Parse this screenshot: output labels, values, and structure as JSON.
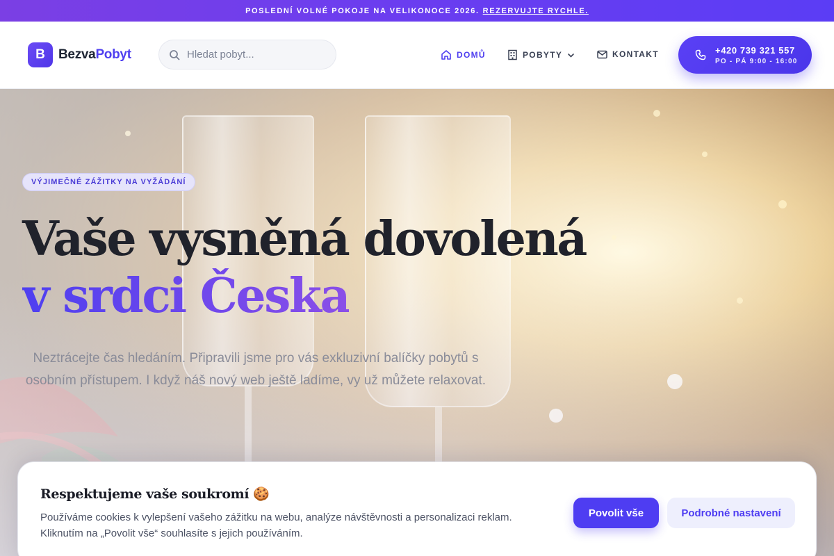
{
  "announcement": {
    "text": "POSLEDNÍ VOLNÉ POKOJE NA VELIKONOCE 2026.",
    "link_label": "REZERVUJTE RYCHLE."
  },
  "header": {
    "logo_letter": "B",
    "brand_part1": "Bezva",
    "brand_part2": "Pobyt",
    "search_placeholder": "Hledat pobyt...",
    "nav": {
      "home": "DOMŮ",
      "stays": "POBYTY",
      "contact": "KONTAKT"
    },
    "phone": {
      "number": "+420 739 321 557",
      "hours": "PO - PÁ 9:00 - 16:00"
    }
  },
  "hero": {
    "badge": "VÝJIMEČNÉ ZÁŽITKY NA VYŽÁDÁNÍ",
    "title_line1": "Vaše vysněná dovolená",
    "title_line2": "v srdci Česka",
    "lead": "Neztrácejte čas hledáním. Připravili jsme pro vás exkluzivní balíčky pobytů s osobním přístupem. I když náš nový web ještě ladíme, vy už můžete relaxovat."
  },
  "cookie": {
    "title": "Respektujeme vaše soukromí 🍪",
    "text": "Používáme cookies k vylepšení vašeho zážitku na webu, analýze návštěvnosti a personalizaci reklam. Kliknutím na „Povolit vše“ souhlasíte s jejich používáním.",
    "accept_label": "Povolit vše",
    "settings_label": "Podrobné nastavení"
  },
  "colors": {
    "accent": "#4f3ff0",
    "banner_start": "#7b3fe4",
    "banner_end": "#5b3df5"
  },
  "icons": {
    "search": "search-icon",
    "home": "home-icon",
    "building": "building-icon",
    "mail": "mail-icon",
    "phone": "phone-icon",
    "chevron": "chevron-down-icon"
  }
}
